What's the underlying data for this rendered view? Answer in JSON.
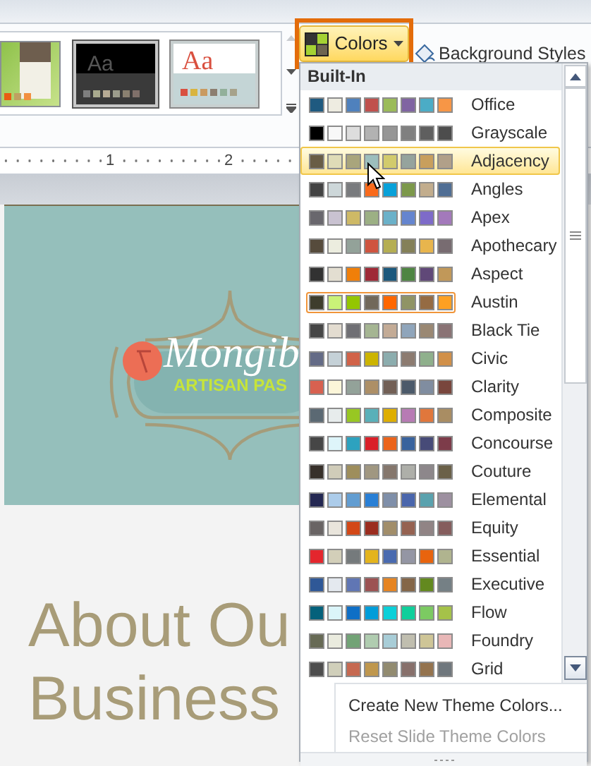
{
  "ribbon": {
    "themes": [
      {
        "kind": "green"
      },
      {
        "kind": "dark",
        "label": "Aa"
      },
      {
        "kind": "light",
        "label": "Aa"
      }
    ],
    "colors_button": {
      "label": "Colors",
      "selected": true
    },
    "background_styles_button": {
      "label": "Background Styles"
    }
  },
  "ruler": {
    "marks": [
      "1",
      "2"
    ]
  },
  "slide": {
    "logo_name": "Mongib",
    "logo_tagline": "ARTISAN PAS",
    "title_lines": [
      "About Ou",
      "Business"
    ]
  },
  "colors_menu": {
    "section": "Built-In",
    "items": [
      {
        "name": "Office",
        "hovered": false,
        "selected": false,
        "colors": [
          {
            "color": "#1f5a80"
          },
          {
            "color": "#eeece1"
          },
          {
            "color": "#4f81bd"
          },
          {
            "color": "#c0504d"
          },
          {
            "color": "#9bbb59"
          },
          {
            "color": "#8064a2"
          },
          {
            "color": "#4bacc6"
          },
          {
            "color": "#f79646"
          }
        ]
      },
      {
        "name": "Grayscale",
        "hovered": false,
        "selected": false,
        "colors": [
          {
            "color": "#000000"
          },
          {
            "color": "#f8f8f8"
          },
          {
            "color": "#dddddd"
          },
          {
            "color": "#b2b2b2"
          },
          {
            "color": "#969696"
          },
          {
            "color": "#808080"
          },
          {
            "color": "#5f5f5f"
          },
          {
            "color": "#4d4d4d"
          }
        ]
      },
      {
        "name": "Adjacency",
        "hovered": true,
        "selected": false,
        "colors": [
          {
            "color": "#695d46"
          },
          {
            "color": "#dfdcb7"
          },
          {
            "color": "#a9a57c"
          },
          {
            "color": "#9cbebd"
          },
          {
            "color": "#d2cb6c"
          },
          {
            "color": "#95a39d"
          },
          {
            "color": "#c89f5d"
          },
          {
            "color": "#b1a089"
          }
        ]
      },
      {
        "name": "Angles",
        "hovered": false,
        "selected": false,
        "colors": [
          {
            "color": "#434343"
          },
          {
            "color": "#cdd7d9"
          },
          {
            "color": "#797b7e"
          },
          {
            "color": "#f96a1b"
          },
          {
            "color": "#08a1d9"
          },
          {
            "color": "#7c984a"
          },
          {
            "color": "#c2ad8d"
          },
          {
            "color": "#506e94"
          }
        ]
      },
      {
        "name": "Apex",
        "hovered": false,
        "selected": false,
        "colors": [
          {
            "color": "#69676d"
          },
          {
            "color": "#c9c2d1"
          },
          {
            "color": "#ceb966"
          },
          {
            "color": "#9cb084"
          },
          {
            "color": "#6bb1c9"
          },
          {
            "color": "#6585cf"
          },
          {
            "color": "#7e6bc9"
          },
          {
            "color": "#a379bb"
          }
        ]
      },
      {
        "name": "Apothecary",
        "hovered": false,
        "selected": false,
        "colors": [
          {
            "color": "#564b3c"
          },
          {
            "color": "#eceddf"
          },
          {
            "color": "#93a299"
          },
          {
            "color": "#cf543f"
          },
          {
            "color": "#b5ae53"
          },
          {
            "color": "#848058"
          },
          {
            "color": "#e8b54d"
          },
          {
            "color": "#786c71"
          }
        ]
      },
      {
        "name": "Aspect",
        "hovered": false,
        "selected": false,
        "colors": [
          {
            "color": "#323232"
          },
          {
            "color": "#e3ded1"
          },
          {
            "color": "#f07f09"
          },
          {
            "color": "#9f2936"
          },
          {
            "color": "#1b587c"
          },
          {
            "color": "#4e8542"
          },
          {
            "color": "#604878"
          },
          {
            "color": "#c19859"
          }
        ]
      },
      {
        "name": "Austin",
        "hovered": false,
        "selected": true,
        "colors": [
          {
            "color": "#3e3d2d"
          },
          {
            "color": "#caf278"
          },
          {
            "color": "#94c600"
          },
          {
            "color": "#71685a"
          },
          {
            "color": "#ff6700"
          },
          {
            "color": "#909465"
          },
          {
            "color": "#956b43"
          },
          {
            "color": "#fea022"
          }
        ]
      },
      {
        "name": "Black Tie",
        "hovered": false,
        "selected": false,
        "colors": [
          {
            "color": "#464646"
          },
          {
            "color": "#e3dcd0"
          },
          {
            "color": "#6f6f74"
          },
          {
            "color": "#a5b592"
          },
          {
            "color": "#c3ab96"
          },
          {
            "color": "#8fa5bb"
          },
          {
            "color": "#9a8873"
          },
          {
            "color": "#8a7375"
          }
        ]
      },
      {
        "name": "Civic",
        "hovered": false,
        "selected": false,
        "colors": [
          {
            "color": "#646b86"
          },
          {
            "color": "#c5d1d7"
          },
          {
            "color": "#d16349"
          },
          {
            "color": "#ccb400"
          },
          {
            "color": "#8cadae"
          },
          {
            "color": "#8c7b70"
          },
          {
            "color": "#8fb08c"
          },
          {
            "color": "#d19049"
          }
        ]
      },
      {
        "name": "Clarity",
        "hovered": false,
        "selected": false,
        "colors": [
          {
            "color": "#d86150"
          },
          {
            "color": "#fcf6d9"
          },
          {
            "color": "#93a299"
          },
          {
            "color": "#ad8f67"
          },
          {
            "color": "#726056"
          },
          {
            "color": "#4c5a6a"
          },
          {
            "color": "#808da0"
          },
          {
            "color": "#79463d"
          }
        ]
      },
      {
        "name": "Composite",
        "hovered": false,
        "selected": false,
        "colors": [
          {
            "color": "#5b6973"
          },
          {
            "color": "#e7ecec"
          },
          {
            "color": "#98c723"
          },
          {
            "color": "#59b0b9"
          },
          {
            "color": "#deae00"
          },
          {
            "color": "#b77bb4"
          },
          {
            "color": "#e0773c"
          },
          {
            "color": "#a98d63"
          }
        ]
      },
      {
        "name": "Concourse",
        "hovered": false,
        "selected": false,
        "colors": [
          {
            "color": "#464646"
          },
          {
            "color": "#def5fa"
          },
          {
            "color": "#2da2bf"
          },
          {
            "color": "#da1f28"
          },
          {
            "color": "#eb641b"
          },
          {
            "color": "#39639d"
          },
          {
            "color": "#474b78"
          },
          {
            "color": "#7d3c4a"
          }
        ]
      },
      {
        "name": "Couture",
        "hovered": false,
        "selected": false,
        "colors": [
          {
            "color": "#37302a"
          },
          {
            "color": "#d0ccb9"
          },
          {
            "color": "#9e8e5c"
          },
          {
            "color": "#a09781"
          },
          {
            "color": "#85776d"
          },
          {
            "color": "#aeafa9"
          },
          {
            "color": "#8d878b"
          },
          {
            "color": "#6b6149"
          }
        ]
      },
      {
        "name": "Elemental",
        "hovered": false,
        "selected": false,
        "colors": [
          {
            "color": "#242852"
          },
          {
            "color": "#acccea"
          },
          {
            "color": "#629dd1"
          },
          {
            "color": "#297fd5"
          },
          {
            "color": "#7f8fa9"
          },
          {
            "color": "#4a66ac"
          },
          {
            "color": "#5aa2ae"
          },
          {
            "color": "#9d90a0"
          }
        ]
      },
      {
        "name": "Equity",
        "hovered": false,
        "selected": false,
        "colors": [
          {
            "color": "#696464"
          },
          {
            "color": "#e9e5dc"
          },
          {
            "color": "#d34817"
          },
          {
            "color": "#9b2d1f"
          },
          {
            "color": "#a28e6a"
          },
          {
            "color": "#956251"
          },
          {
            "color": "#918485"
          },
          {
            "color": "#855d5d"
          }
        ]
      },
      {
        "name": "Essential",
        "hovered": false,
        "selected": false,
        "colors": [
          {
            "color": "#e4262d"
          },
          {
            "color": "#d3cfb9"
          },
          {
            "color": "#757a7c"
          },
          {
            "color": "#e4b41c"
          },
          {
            "color": "#4a6bb0"
          },
          {
            "color": "#9496a4"
          },
          {
            "color": "#e8640e"
          },
          {
            "color": "#b0b48f"
          }
        ]
      },
      {
        "name": "Executive",
        "hovered": false,
        "selected": false,
        "colors": [
          {
            "color": "#2f5897"
          },
          {
            "color": "#e4e9ef"
          },
          {
            "color": "#6076b4"
          },
          {
            "color": "#9c5252"
          },
          {
            "color": "#e68422"
          },
          {
            "color": "#846648"
          },
          {
            "color": "#63891f"
          },
          {
            "color": "#758085"
          }
        ]
      },
      {
        "name": "Flow",
        "hovered": false,
        "selected": false,
        "colors": [
          {
            "color": "#04617b"
          },
          {
            "color": "#dbf5f9"
          },
          {
            "color": "#0f6fc6"
          },
          {
            "color": "#009dd9"
          },
          {
            "color": "#0bd0d9"
          },
          {
            "color": "#10cf9b"
          },
          {
            "color": "#7cca62"
          },
          {
            "color": "#a5c249"
          }
        ]
      },
      {
        "name": "Foundry",
        "hovered": false,
        "selected": false,
        "colors": [
          {
            "color": "#676a55"
          },
          {
            "color": "#eaebde"
          },
          {
            "color": "#72a376"
          },
          {
            "color": "#b0ccb0"
          },
          {
            "color": "#a8cdd7"
          },
          {
            "color": "#c0beaf"
          },
          {
            "color": "#cec597"
          },
          {
            "color": "#e8b7b7"
          }
        ]
      },
      {
        "name": "Grid",
        "hovered": false,
        "selected": false,
        "colors": [
          {
            "color": "#4d4d4d"
          },
          {
            "color": "#d0cfba"
          },
          {
            "color": "#c66951"
          },
          {
            "color": "#bf974d"
          },
          {
            "color": "#928b70"
          },
          {
            "color": "#87706b"
          },
          {
            "color": "#94734e"
          },
          {
            "color": "#6f777d"
          }
        ]
      }
    ],
    "actions": [
      {
        "label": "Create New Theme Colors...",
        "disabled": false
      },
      {
        "label": "Reset Slide Theme Colors",
        "disabled": true
      }
    ]
  }
}
